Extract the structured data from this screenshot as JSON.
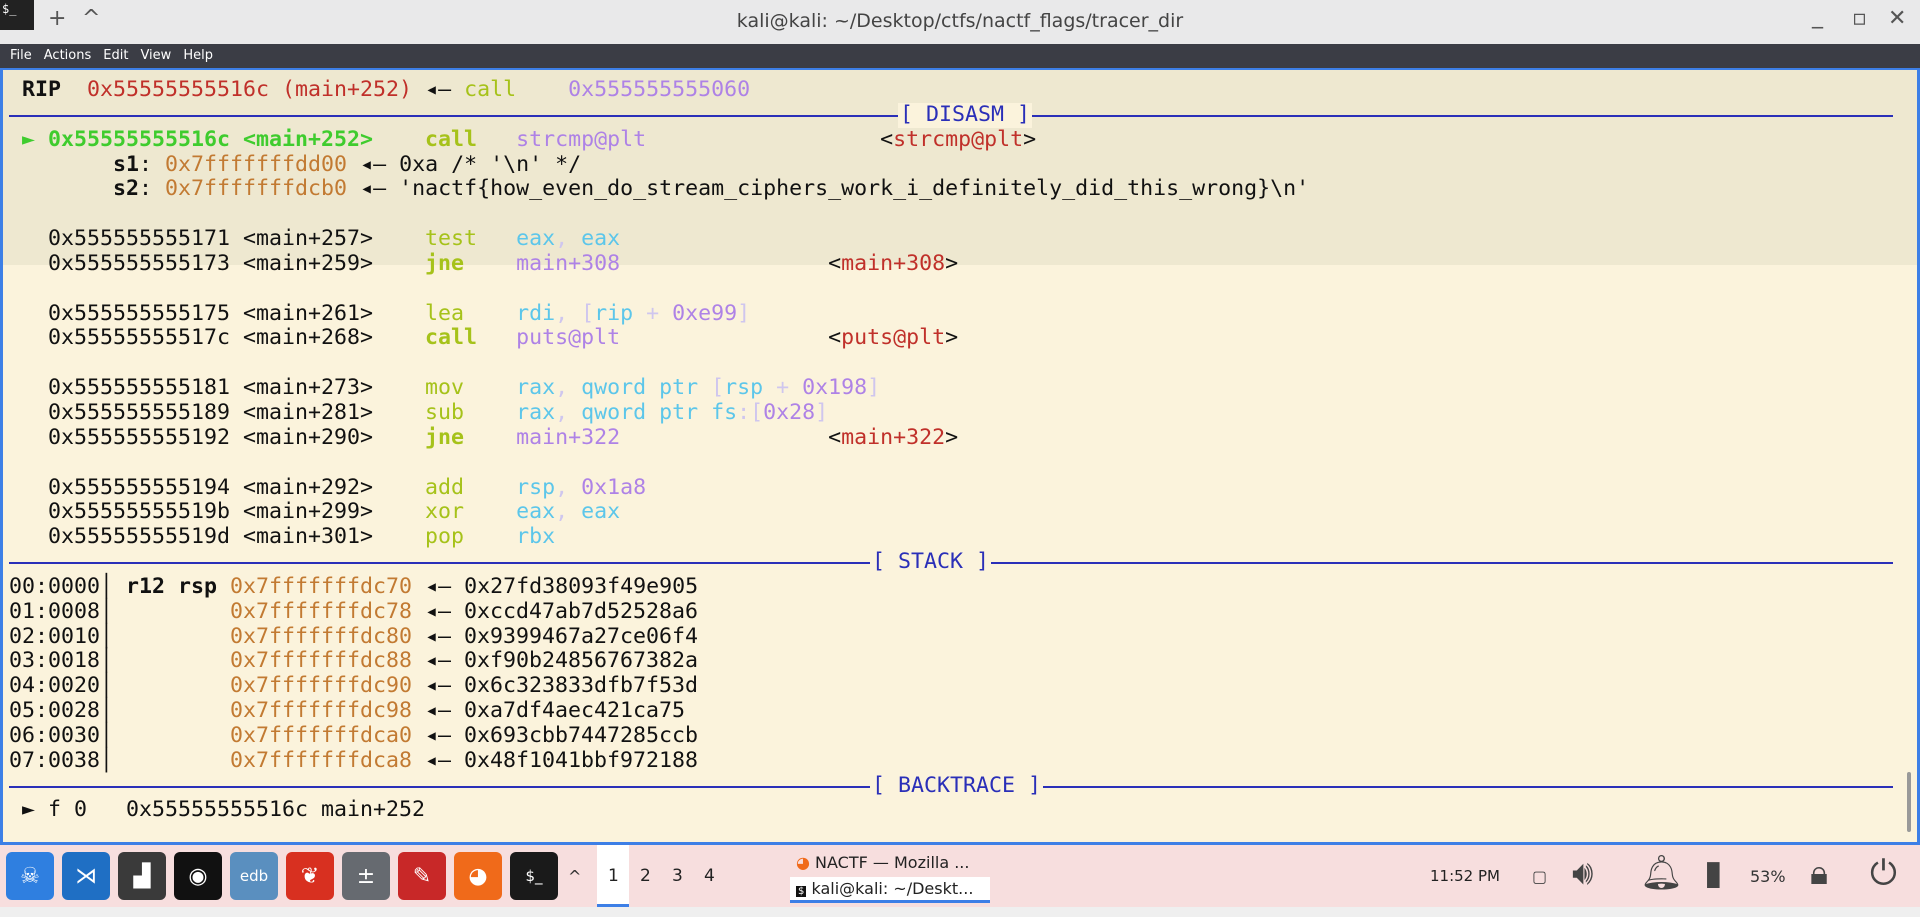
{
  "window": {
    "title": "kali@kali: ~/Desktop/ctfs/nactf_flags/tracer_dir",
    "new_tab": "+",
    "collapse": "^",
    "minimize": "_",
    "maximize": "▫",
    "close": "✕",
    "app_icon": "$_"
  },
  "menu": [
    "File",
    "Actions",
    "Edit",
    "View",
    "Help"
  ],
  "colors": {
    "W": "#111111",
    "R": "#c0302a",
    "Y": "#a6c21a",
    "P": "#ae82e6",
    "C": "#5cc6ea",
    "L": "#cfc6ee",
    "O": "#c27a32",
    "G": "#3fcc2e",
    "B": "#2a2fb8"
  },
  "lines": [
    [
      {
        "t": " RIP",
        "c": "W",
        "b": 1
      },
      {
        "t": "  "
      },
      {
        "t": "0x55555555516c",
        "c": "R"
      },
      {
        "t": " (main+252)",
        "c": "R"
      },
      {
        "t": " ◂— "
      },
      {
        "t": "call",
        "c": "Y"
      },
      {
        "t": "    "
      },
      {
        "t": "0x555555555060",
        "c": "P"
      }
    ],
    {
      "rule": "[ DISASM ]"
    },
    [
      {
        "t": " ► ",
        "c": "G"
      },
      {
        "t": "0x55555555516c <main+252>",
        "c": "G",
        "b": 1
      },
      {
        "t": "    "
      },
      {
        "t": "call",
        "c": "Y",
        "b": 1
      },
      {
        "t": "   "
      },
      {
        "t": "strcmp@plt",
        "c": "P"
      },
      {
        "t": "                  <"
      },
      {
        "t": "strcmp@plt",
        "c": "R"
      },
      {
        "t": ">"
      }
    ],
    [
      {
        "t": "        "
      },
      {
        "t": "s1",
        "c": "W",
        "b": 1
      },
      {
        "t": ": "
      },
      {
        "t": "0x7fffffffdd00",
        "c": "O"
      },
      {
        "t": " ◂— 0xa /* '\\n' */"
      }
    ],
    [
      {
        "t": "        "
      },
      {
        "t": "s2",
        "c": "W",
        "b": 1
      },
      {
        "t": ": "
      },
      {
        "t": "0x7fffffffdcb0",
        "c": "O"
      },
      {
        "t": " ◂— 'nactf{how_even_do_stream_ciphers_work_i_definitely_did_this_wrong}\\n'"
      }
    ],
    [],
    [
      {
        "t": "   0x555555555171 <main+257>    "
      },
      {
        "t": "test",
        "c": "Y"
      },
      {
        "t": "   "
      },
      {
        "t": "eax",
        "c": "C"
      },
      {
        "t": ", ",
        "c": "L"
      },
      {
        "t": "eax",
        "c": "C"
      }
    ],
    [
      {
        "t": "   0x555555555173 <main+259>    "
      },
      {
        "t": "jne",
        "c": "Y",
        "b": 1
      },
      {
        "t": "    "
      },
      {
        "t": "main+308",
        "c": "P"
      },
      {
        "t": "                <"
      },
      {
        "t": "main+308",
        "c": "R"
      },
      {
        "t": ">"
      }
    ],
    [],
    [
      {
        "t": "   0x555555555175 <main+261>    "
      },
      {
        "t": "lea",
        "c": "Y"
      },
      {
        "t": "    "
      },
      {
        "t": "rdi",
        "c": "C"
      },
      {
        "t": ", [",
        "c": "L"
      },
      {
        "t": "rip",
        "c": "C"
      },
      {
        "t": " + ",
        "c": "L"
      },
      {
        "t": "0xe99",
        "c": "P"
      },
      {
        "t": "]",
        "c": "L"
      }
    ],
    [
      {
        "t": "   0x55555555517c <main+268>    "
      },
      {
        "t": "call",
        "c": "Y",
        "b": 1
      },
      {
        "t": "   "
      },
      {
        "t": "puts@plt",
        "c": "P"
      },
      {
        "t": "                <"
      },
      {
        "t": "puts@plt",
        "c": "R"
      },
      {
        "t": ">"
      }
    ],
    [],
    [
      {
        "t": "   0x555555555181 <main+273>    "
      },
      {
        "t": "mov",
        "c": "Y"
      },
      {
        "t": "    "
      },
      {
        "t": "rax",
        "c": "C"
      },
      {
        "t": ", ",
        "c": "L"
      },
      {
        "t": "qword ptr",
        "c": "C"
      },
      {
        "t": " [",
        "c": "L"
      },
      {
        "t": "rsp",
        "c": "C"
      },
      {
        "t": " + ",
        "c": "L"
      },
      {
        "t": "0x198",
        "c": "P"
      },
      {
        "t": "]",
        "c": "L"
      }
    ],
    [
      {
        "t": "   0x555555555189 <main+281>    "
      },
      {
        "t": "sub",
        "c": "Y"
      },
      {
        "t": "    "
      },
      {
        "t": "rax",
        "c": "C"
      },
      {
        "t": ", ",
        "c": "L"
      },
      {
        "t": "qword ptr fs",
        "c": "C"
      },
      {
        "t": ":[",
        "c": "L"
      },
      {
        "t": "0x28",
        "c": "P"
      },
      {
        "t": "]",
        "c": "L"
      }
    ],
    [
      {
        "t": "   0x555555555192 <main+290>    "
      },
      {
        "t": "jne",
        "c": "Y",
        "b": 1
      },
      {
        "t": "    "
      },
      {
        "t": "main+322",
        "c": "P"
      },
      {
        "t": "                <"
      },
      {
        "t": "main+322",
        "c": "R"
      },
      {
        "t": ">"
      }
    ],
    [],
    [
      {
        "t": "   0x555555555194 <main+292>    "
      },
      {
        "t": "add",
        "c": "Y"
      },
      {
        "t": "    "
      },
      {
        "t": "rsp",
        "c": "C"
      },
      {
        "t": ", ",
        "c": "L"
      },
      {
        "t": "0x1a8",
        "c": "P"
      }
    ],
    [
      {
        "t": "   0x55555555519b <main+299>    "
      },
      {
        "t": "xor",
        "c": "Y"
      },
      {
        "t": "    "
      },
      {
        "t": "eax",
        "c": "C"
      },
      {
        "t": ", ",
        "c": "L"
      },
      {
        "t": "eax",
        "c": "C"
      }
    ],
    [
      {
        "t": "   0x55555555519d <main+301>    "
      },
      {
        "t": "pop",
        "c": "Y"
      },
      {
        "t": "    "
      },
      {
        "t": "rbx",
        "c": "C"
      }
    ],
    {
      "rule": "[ STACK ]"
    },
    [
      {
        "t": "00:0000│ "
      },
      {
        "t": "r12 rsp",
        "c": "W",
        "b": 1
      },
      {
        "t": " "
      },
      {
        "t": "0x7fffffffdc70",
        "c": "O"
      },
      {
        "t": " ◂— 0x27fd38093f49e905"
      }
    ],
    [
      {
        "t": "01:0008│         "
      },
      {
        "t": "0x7fffffffdc78",
        "c": "O"
      },
      {
        "t": " ◂— 0xccd47ab7d52528a6"
      }
    ],
    [
      {
        "t": "02:0010│         "
      },
      {
        "t": "0x7fffffffdc80",
        "c": "O"
      },
      {
        "t": " ◂— 0x9399467a27ce06f4"
      }
    ],
    [
      {
        "t": "03:0018│         "
      },
      {
        "t": "0x7fffffffdc88",
        "c": "O"
      },
      {
        "t": " ◂— 0xf90b24856767382a"
      }
    ],
    [
      {
        "t": "04:0020│         "
      },
      {
        "t": "0x7fffffffdc90",
        "c": "O"
      },
      {
        "t": " ◂— 0x6c323833dfb7f53d"
      }
    ],
    [
      {
        "t": "05:0028│         "
      },
      {
        "t": "0x7fffffffdc98",
        "c": "O"
      },
      {
        "t": " ◂— 0xa7df4aec421ca75"
      }
    ],
    [
      {
        "t": "06:0030│         "
      },
      {
        "t": "0x7fffffffdca0",
        "c": "O"
      },
      {
        "t": " ◂— 0x693cbb7447285ccb"
      }
    ],
    [
      {
        "t": "07:0038│         "
      },
      {
        "t": "0x7fffffffdca8",
        "c": "O"
      },
      {
        "t": " ◂— 0x48f1041bbf972188"
      }
    ],
    {
      "rule": "[ BACKTRACE ]"
    },
    [
      {
        "t": " ► f 0   0x55555555516c main+252"
      }
    ]
  ],
  "taskbar": {
    "apps": [
      {
        "name": "kali-menu",
        "glyph": "☠",
        "color": "#2f7fe0"
      },
      {
        "name": "vscode",
        "glyph": "⋊",
        "color": "#1f6fc4"
      },
      {
        "name": "system-monitor",
        "glyph": "▟",
        "color": "#3a3a3a"
      },
      {
        "name": "ghidra",
        "glyph": "◉",
        "color": "#111111"
      },
      {
        "name": "edb",
        "glyph": "edb",
        "color": "#5a8fbf"
      },
      {
        "name": "burp",
        "glyph": "❦",
        "color": "#d83020"
      },
      {
        "name": "calculator",
        "glyph": "±",
        "color": "#666a70"
      },
      {
        "name": "text-editor",
        "glyph": "✎",
        "color": "#c82828"
      },
      {
        "name": "firefox",
        "glyph": "◕",
        "color": "#f06a1a"
      },
      {
        "name": "terminal",
        "glyph": "$_",
        "color": "#1a1a1a"
      }
    ],
    "expand": "^",
    "workspaces": [
      "1",
      "2",
      "3",
      "4"
    ],
    "tasks": [
      "NACTF — Mozilla ...",
      "kali@kali: ~/Deskt..."
    ],
    "clock": "11:52 PM",
    "battery": "53%"
  }
}
